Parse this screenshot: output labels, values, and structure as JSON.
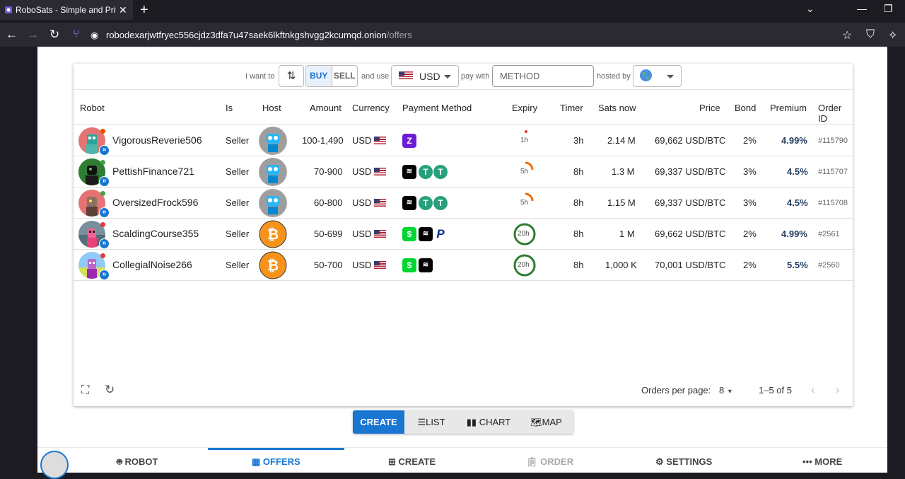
{
  "browser": {
    "tab_title": "RoboSats - Simple and Private",
    "url_host": "robodexarjwtfryec556cjdz3dfa7u47saek6lkftnkgshvgg2kcumqd.onion",
    "url_path": "/offers"
  },
  "filters": {
    "i_want_to": "I want to",
    "buy": "BUY",
    "sell": "SELL",
    "and_use": "and use",
    "currency": "USD",
    "pay_with": "pay with",
    "method_placeholder": "METHOD",
    "hosted_by": "hosted by"
  },
  "columns": [
    "Robot",
    "Is",
    "Host",
    "Amount",
    "Currency",
    "Payment Method",
    "Expiry",
    "Timer",
    "Sats now",
    "Price",
    "Bond",
    "Premium",
    "Order ID"
  ],
  "orders": [
    {
      "robot": "VigorousReverie506",
      "is": "Seller",
      "amount": "100-1,490",
      "currency": "USD",
      "expiry": "1h",
      "timer": "3h",
      "sats": "2.14 M",
      "price": "69,662 USD/BTC",
      "bond": "2%",
      "premium": "4.99%",
      "order_id": "#115790",
      "dot": "#e65100",
      "avatar_bg": "#e57373"
    },
    {
      "robot": "PettishFinance721",
      "is": "Seller",
      "amount": "70-900",
      "currency": "USD",
      "expiry": "5h",
      "timer": "8h",
      "sats": "1.3 M",
      "price": "69,337 USD/BTC",
      "bond": "3%",
      "premium": "4.5%",
      "order_id": "#115707",
      "dot": "#43a047",
      "avatar_bg": "#1b5e20"
    },
    {
      "robot": "OversizedFrock596",
      "is": "Seller",
      "amount": "60-800",
      "currency": "USD",
      "expiry": "5h",
      "timer": "8h",
      "sats": "1.15 M",
      "price": "69,337 USD/BTC",
      "bond": "3%",
      "premium": "4.5%",
      "order_id": "#115708",
      "dot": "#43a047",
      "avatar_bg": "#e57373"
    },
    {
      "robot": "ScaldingCourse355",
      "is": "Seller",
      "amount": "50-699",
      "currency": "USD",
      "expiry": "20h",
      "timer": "8h",
      "sats": "1 M",
      "price": "69,662 USD/BTC",
      "bond": "2%",
      "premium": "4.99%",
      "order_id": "#2561",
      "dot": "#e53935",
      "avatar_bg": "#78909c"
    },
    {
      "robot": "CollegialNoise266",
      "is": "Seller",
      "amount": "50-700",
      "currency": "USD",
      "expiry": "20h",
      "timer": "8h",
      "sats": "1,000 K",
      "price": "70,001 USD/BTC",
      "bond": "2%",
      "premium": "5.5%",
      "order_id": "#2560",
      "dot": "#e53935",
      "avatar_bg": "#90caf9"
    }
  ],
  "pagination": {
    "orders_per_page_label": "Orders per page:",
    "orders_per_page": "8",
    "range": "1–5 of 5"
  },
  "view_buttons": {
    "create": "CREATE",
    "list": "LIST",
    "chart": "CHART",
    "map": "MAP"
  },
  "bottom_nav": {
    "robot": "ROBOT",
    "offers": "OFFERS",
    "create": "CREATE",
    "order": "ORDER",
    "settings": "SETTINGS",
    "more": "MORE"
  },
  "colors": {
    "primary": "#1976d2",
    "bitcoin_orange": "#f7931a",
    "cashapp_green": "#00d632",
    "tether_teal": "#26a17b"
  }
}
